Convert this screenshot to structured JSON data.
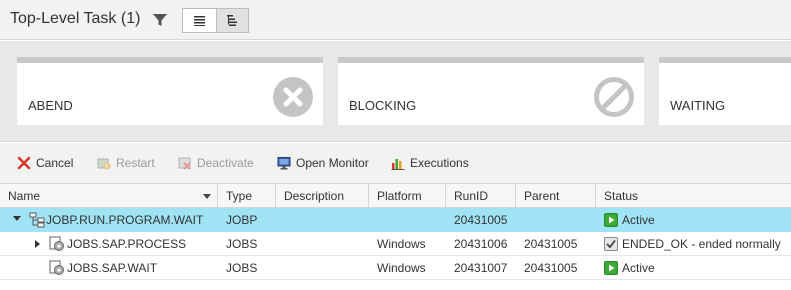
{
  "header": {
    "title": "Top-Level Task (1)",
    "filter_icon": "funnel-icon",
    "view_list_icon": "list-view-icon",
    "view_tree_icon": "tree-view-icon"
  },
  "status_cards": [
    {
      "label": "ABEND",
      "icon": "x-circle-icon"
    },
    {
      "label": "BLOCKING",
      "icon": "blocked-circle-icon"
    },
    {
      "label": "WAITING",
      "icon": ""
    }
  ],
  "toolbar": {
    "cancel": "Cancel",
    "restart": "Restart",
    "deactivate": "Deactivate",
    "open_monitor": "Open Monitor",
    "executions": "Executions"
  },
  "columns": {
    "name": "Name",
    "type": "Type",
    "description": "Description",
    "platform": "Platform",
    "runid": "RunID",
    "parent": "Parent",
    "status": "Status"
  },
  "rows": [
    {
      "name": "JOBP.RUN.PROGRAM.WAIT",
      "type": "JOBP",
      "description": "",
      "platform": "",
      "runid": "20431005",
      "parent": "",
      "status": "Active",
      "status_icon": "play-icon",
      "selected": true,
      "expander": "down",
      "level": 0
    },
    {
      "name": "JOBS.SAP.PROCESS",
      "type": "JOBS",
      "description": "",
      "platform": "Windows",
      "runid": "20431006",
      "parent": "20431005",
      "status": "ENDED_OK - ended normally",
      "status_icon": "checkmark-icon",
      "selected": false,
      "expander": "right",
      "level": 1
    },
    {
      "name": "JOBS.SAP.WAIT",
      "type": "JOBS",
      "description": "",
      "platform": "Windows",
      "runid": "20431007",
      "parent": "20431005",
      "status": "Active",
      "status_icon": "play-icon",
      "selected": false,
      "expander": "",
      "level": 1
    }
  ],
  "colors": {
    "selected_row": "#9fe3f4",
    "active_green": "#3aaa35",
    "card_icon_gray": "#c4c4c4",
    "cancel_red": "#d9372b"
  }
}
